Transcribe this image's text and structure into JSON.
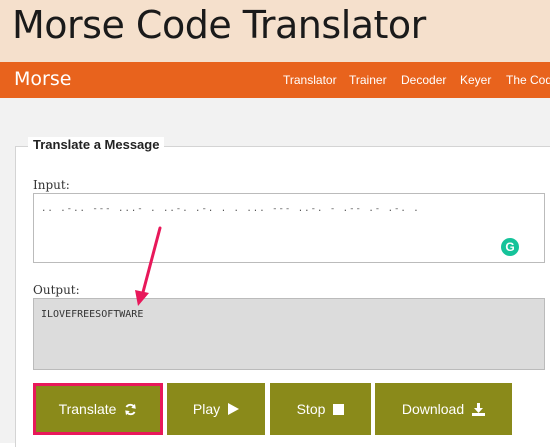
{
  "header": {
    "title": "Morse Code Translator"
  },
  "navbar": {
    "brand": "Morse",
    "links": [
      "Translator",
      "Trainer",
      "Decoder",
      "Keyer",
      "The Code"
    ]
  },
  "form": {
    "legend": "Translate a Message",
    "input_label": "Input:",
    "input_value": ".. .-.. --- ...- . ..-. .-. . . ... --- ..-. - .-- .- .-. .",
    "output_label": "Output:",
    "output_value": "ILOVEFREESOFTWARE"
  },
  "buttons": {
    "translate": "Translate",
    "play": "Play",
    "stop": "Stop",
    "download": "Download"
  },
  "colors": {
    "title_bg": "#f5e0cc",
    "nav_bg": "#e8631d",
    "button_bg": "#8a8a1a",
    "highlight": "#e8185a",
    "grammarly": "#15c39a"
  },
  "icons": {
    "translate": "refresh-icon",
    "play": "play-icon",
    "stop": "stop-icon",
    "download": "download-icon",
    "extension": "grammarly-icon"
  }
}
